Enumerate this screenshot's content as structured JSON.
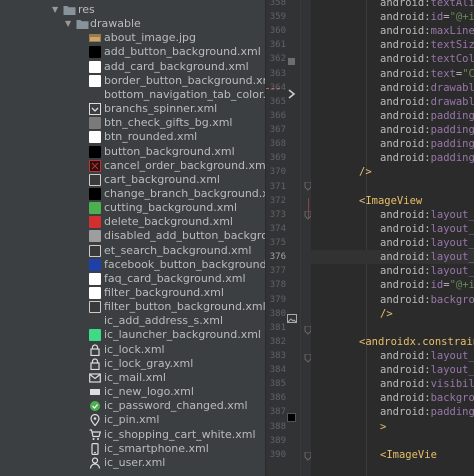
{
  "tree": {
    "items": [
      {
        "label": "res",
        "indent": 0,
        "icon": "folder-icon",
        "expanded": true
      },
      {
        "label": "drawable",
        "indent": 1,
        "icon": "folder-icon",
        "expanded": true
      },
      {
        "label": "about_image.jpg",
        "indent": 2,
        "icon": "image-thumbnail-icon"
      },
      {
        "label": "add_button_background.xml",
        "indent": 2,
        "icon": "swatch-icon",
        "color": "#000000"
      },
      {
        "label": "add_card_background.xml",
        "indent": 2,
        "icon": "swatch-icon",
        "color": "#ffffff"
      },
      {
        "label": "border_button_background.xml",
        "indent": 2,
        "icon": "swatch-icon",
        "color": "#ffffff"
      },
      {
        "label": "bottom_navigation_tab_color.xml",
        "indent": 2,
        "icon": "blank-icon"
      },
      {
        "label": "branchs_spinner.xml",
        "indent": 2,
        "icon": "spinner-icon"
      },
      {
        "label": "btn_check_gifts_bg.xml",
        "indent": 2,
        "icon": "swatch-icon",
        "color": "#7a7a7a"
      },
      {
        "label": "btn_rounded.xml",
        "indent": 2,
        "icon": "swatch-icon",
        "color": "#ffffff"
      },
      {
        "label": "button_background.xml",
        "indent": 2,
        "icon": "swatch-icon",
        "color": "#000000"
      },
      {
        "label": "cancel_order_background.xml",
        "indent": 2,
        "icon": "cancel-swatch-icon",
        "color": "#7a1a1a"
      },
      {
        "label": "cart_background.xml",
        "indent": 2,
        "icon": "swatch-icon",
        "color": "#3a3a3a",
        "border": "#cccccc"
      },
      {
        "label": "change_branch_background.xml",
        "indent": 2,
        "icon": "swatch-icon",
        "color": "#000000"
      },
      {
        "label": "cutting_background.xml",
        "indent": 2,
        "icon": "swatch-icon",
        "color": "#4caf50"
      },
      {
        "label": "delete_background.xml",
        "indent": 2,
        "icon": "swatch-icon",
        "color": "#d32f2f"
      },
      {
        "label": "disabled_add_button_background.xml",
        "indent": 2,
        "icon": "swatch-icon",
        "color": "#9e9e9e"
      },
      {
        "label": "et_search_background.xml",
        "indent": 2,
        "icon": "swatch-icon",
        "color": "#3a3a3a",
        "border": "#cccccc"
      },
      {
        "label": "facebook_button_background.xml",
        "indent": 2,
        "icon": "swatch-icon",
        "color": "#1e40a8"
      },
      {
        "label": "faq_card_background.xml",
        "indent": 2,
        "icon": "swatch-icon",
        "color": "#ffffff"
      },
      {
        "label": "filter_background.xml",
        "indent": 2,
        "icon": "swatch-icon",
        "color": "#ffffff"
      },
      {
        "label": "filter_button_background.xml",
        "indent": 2,
        "icon": "swatch-icon",
        "color": "#3a3a3a",
        "border": "#cccccc"
      },
      {
        "label": "ic_add_address_s.xml",
        "indent": 2,
        "icon": "blank-icon"
      },
      {
        "label": "ic_launcher_background.xml",
        "indent": 2,
        "icon": "swatch-icon",
        "color": "#3ddc84"
      },
      {
        "label": "ic_lock.xml",
        "indent": 2,
        "icon": "lock-icon"
      },
      {
        "label": "ic_lock_gray.xml",
        "indent": 2,
        "icon": "lock-icon"
      },
      {
        "label": "ic_mail.xml",
        "indent": 2,
        "icon": "mail-icon"
      },
      {
        "label": "ic_new_logo.xml",
        "indent": 2,
        "icon": "logo-icon"
      },
      {
        "label": "ic_password_changed.xml",
        "indent": 2,
        "icon": "check-circle-icon"
      },
      {
        "label": "ic_pin.xml",
        "indent": 2,
        "icon": "pin-icon"
      },
      {
        "label": "ic_shopping_cart_white.xml",
        "indent": 2,
        "icon": "cart-icon"
      },
      {
        "label": "ic_smartphone.xml",
        "indent": 2,
        "icon": "smartphone-icon"
      },
      {
        "label": "ic_user.xml",
        "indent": 2,
        "icon": "user-icon"
      }
    ]
  },
  "editor": {
    "current_line": "376",
    "lines": [
      {
        "num": "358",
        "segs": [
          [
            "attr",
            "android:"
          ],
          [
            "ns",
            "textAlig"
          ]
        ]
      },
      {
        "num": "359",
        "segs": [
          [
            "attr",
            "android:"
          ],
          [
            "ns",
            "id"
          ],
          [
            "attr",
            "="
          ],
          [
            "val",
            "\"@+id"
          ]
        ]
      },
      {
        "num": "360",
        "segs": [
          [
            "attr",
            "android:"
          ],
          [
            "ns",
            "maxLines"
          ]
        ]
      },
      {
        "num": "361",
        "segs": [
          [
            "attr",
            "android:"
          ],
          [
            "ns",
            "textSize"
          ]
        ]
      },
      {
        "num": "362",
        "segs": [
          [
            "attr",
            "android:"
          ],
          [
            "ns",
            "textColo"
          ]
        ]
      },
      {
        "num": "363",
        "segs": [
          [
            "attr",
            "android:"
          ],
          [
            "ns",
            "text"
          ],
          [
            "attr",
            "="
          ],
          [
            "val",
            "\"Co"
          ]
        ]
      },
      {
        "num": "364",
        "segs": [
          [
            "attr",
            "android:"
          ],
          [
            "ns",
            "drawable"
          ]
        ]
      },
      {
        "num": "365",
        "segs": [
          [
            "attr",
            "android:"
          ],
          [
            "ns",
            "drawable"
          ]
        ]
      },
      {
        "num": "366",
        "segs": [
          [
            "attr",
            "android:"
          ],
          [
            "ns",
            "paddingS"
          ]
        ]
      },
      {
        "num": "367",
        "segs": [
          [
            "attr",
            "android:"
          ],
          [
            "ns",
            "paddingT"
          ]
        ]
      },
      {
        "num": "368",
        "segs": [
          [
            "attr",
            "android:"
          ],
          [
            "ns",
            "paddingB"
          ]
        ]
      },
      {
        "num": "369",
        "segs": [
          [
            "attr",
            "android:"
          ],
          [
            "ns",
            "paddingE"
          ]
        ]
      },
      {
        "num": "370",
        "segs": [
          [
            "brk",
            "/>"
          ]
        ]
      },
      {
        "num": "371",
        "segs": []
      },
      {
        "num": "372",
        "segs": [
          [
            "brk",
            "<"
          ],
          [
            "tag",
            "ImageView"
          ]
        ]
      },
      {
        "num": "373",
        "segs": [
          [
            "attr",
            "android:"
          ],
          [
            "ns",
            "layout_w"
          ]
        ]
      },
      {
        "num": "374",
        "segs": [
          [
            "attr",
            "android:"
          ],
          [
            "ns",
            "layout_h"
          ]
        ]
      },
      {
        "num": "375",
        "segs": [
          [
            "attr",
            "android:"
          ],
          [
            "ns",
            "layout_m"
          ]
        ]
      },
      {
        "num": "376",
        "segs": [
          [
            "attr",
            "android:"
          ],
          [
            "ns",
            "layout_m"
          ]
        ]
      },
      {
        "num": "377",
        "segs": [
          [
            "attr",
            "android:"
          ],
          [
            "ns",
            "layout_m"
          ]
        ]
      },
      {
        "num": "378",
        "segs": [
          [
            "attr",
            "android:"
          ],
          [
            "ns",
            "id"
          ],
          [
            "attr",
            "="
          ],
          [
            "val",
            "\"@+id"
          ]
        ]
      },
      {
        "num": "379",
        "segs": [
          [
            "attr",
            "android:"
          ],
          [
            "ns",
            "backgrou"
          ]
        ]
      },
      {
        "num": "380",
        "segs": [
          [
            "brk",
            "/>"
          ]
        ]
      },
      {
        "num": "381",
        "segs": []
      },
      {
        "num": "382",
        "segs": [
          [
            "brk",
            "<"
          ],
          [
            "tag",
            "androidx.constraint"
          ]
        ]
      },
      {
        "num": "383",
        "segs": [
          [
            "attr",
            "android:"
          ],
          [
            "ns",
            "layout_w"
          ]
        ]
      },
      {
        "num": "384",
        "segs": [
          [
            "attr",
            "android:"
          ],
          [
            "ns",
            "layout_h"
          ]
        ]
      },
      {
        "num": "385",
        "segs": [
          [
            "attr",
            "android:"
          ],
          [
            "ns",
            "visibili"
          ]
        ]
      },
      {
        "num": "386",
        "segs": [
          [
            "attr",
            "android:"
          ],
          [
            "ns",
            "backgrou"
          ]
        ]
      },
      {
        "num": "387",
        "segs": [
          [
            "attr",
            "android:"
          ],
          [
            "ns",
            "padding"
          ],
          [
            "attr",
            "="
          ]
        ]
      },
      {
        "num": "388",
        "segs": [
          [
            "brk",
            ">"
          ]
        ]
      },
      {
        "num": "389",
        "segs": []
      },
      {
        "num": "390",
        "segs": [
          [
            "brk",
            "<"
          ],
          [
            "tag",
            "ImageVie"
          ]
        ]
      }
    ]
  }
}
